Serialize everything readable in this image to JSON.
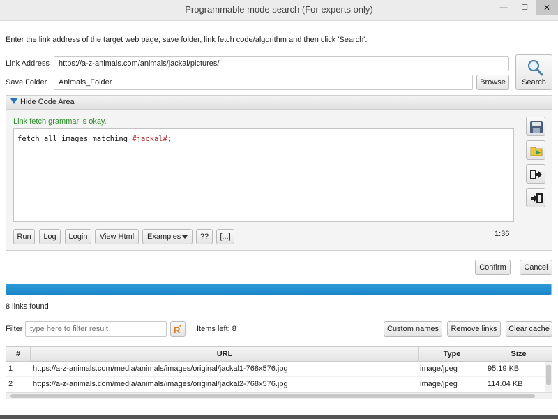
{
  "window": {
    "title": "Programmable mode search (For experts only)",
    "minimize_glyph": "—",
    "maximize_glyph": "☐",
    "close_glyph": "✕"
  },
  "intro_text": "Enter the link address of the target web page, save folder, link fetch code/algorithm and then click 'Search'.",
  "form": {
    "link_label": "Link Address",
    "link_value": "https://a-z-animals.com/animals/jackal/pictures/",
    "folder_label": "Save Folder",
    "folder_value": "Animals_Folder",
    "browse_label": "Browse",
    "search_label": "Search"
  },
  "code_panel": {
    "toggle_label": "Hide Code Area",
    "status_text": "Link fetch grammar is okay.",
    "code_prefix": "fetch all images matching ",
    "code_token": "#jackal#",
    "code_suffix": ";",
    "cursor_position": "1:36",
    "buttons": {
      "run": "Run",
      "log": "Log",
      "login": "Login",
      "view_html": "View Html",
      "examples": "Examples",
      "help": "??",
      "more": "[...]"
    },
    "side_icons": [
      "save-icon",
      "open-folder-icon",
      "export-icon",
      "import-icon"
    ]
  },
  "actions": {
    "confirm": "Confirm",
    "cancel": "Cancel"
  },
  "progress": {
    "value": 1.0,
    "color": "#1f8fd1"
  },
  "results": {
    "links_found": "8 links found",
    "filter_label": "Filter",
    "filter_placeholder": "type here to filter result",
    "items_left": "Items left: 8",
    "custom_names": "Custom names",
    "remove_links": "Remove links",
    "clear_cache": "Clear cache"
  },
  "table": {
    "columns": [
      "#",
      "URL",
      "Type",
      "Size"
    ],
    "rows": [
      {
        "num": "1",
        "url": "https://a-z-animals.com/media/animals/images/original/jackal1-768x576.jpg",
        "type": "image/jpeg",
        "size": "95.19 KB"
      },
      {
        "num": "2",
        "url": "https://a-z-animals.com/media/animals/images/original/jackal2-768x576.jpg",
        "type": "image/jpeg",
        "size": "114.04 KB"
      }
    ]
  },
  "colors": {
    "accent": "#1f8fd1",
    "ok_green": "#2e8b2e",
    "code_token": "#b03030",
    "regex_icon": "#e07b1f"
  }
}
